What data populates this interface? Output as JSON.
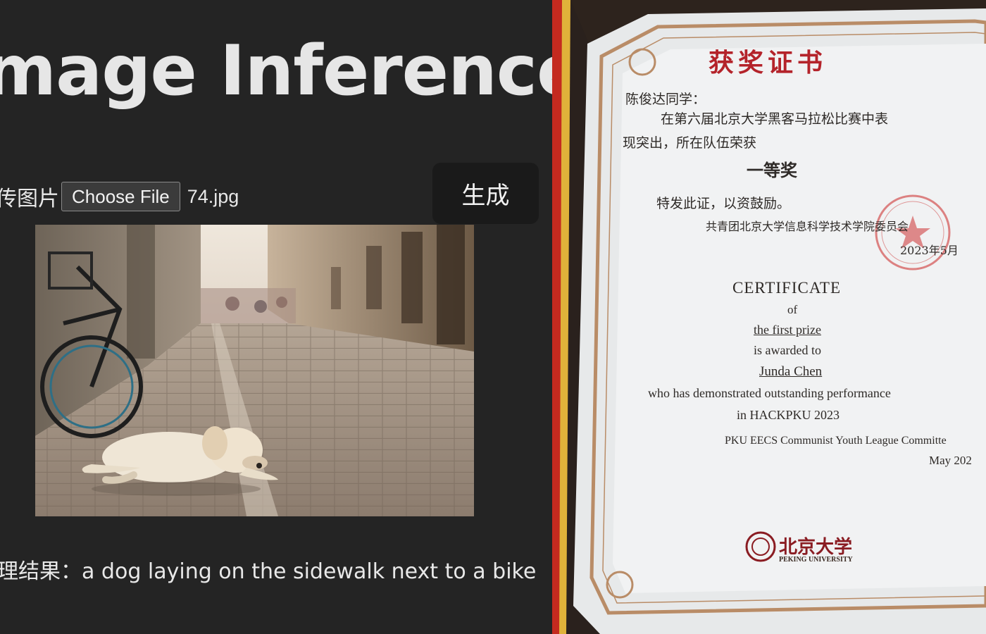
{
  "app": {
    "title": "mage Inference",
    "upload_label": "传图片",
    "choose_file": "Choose File",
    "file_name": "74.jpg",
    "generate": "生成",
    "result_label": "理结果：",
    "result_text": "a dog laying on the sidewalk next to a bike"
  },
  "certificate": {
    "zh_title": "获奖证书",
    "zh_salutation": "陈俊达同学：",
    "zh_body_1": "在第六届北京大学黑客马拉松比赛中表",
    "zh_body_2": "现突出，所在队伍荣获",
    "zh_prize": "一等奖",
    "zh_closing": "特发此证，以资鼓励。",
    "zh_issuer": "共青团北京大学信息科学技术学院委员会",
    "zh_date": "2023年5月",
    "en_title": "CERTIFICATE",
    "en_of": "of",
    "en_prize": "the first prize",
    "en_awarded": "is awarded to",
    "en_name": "Junda Chen",
    "en_reason": "who has demonstrated outstanding performance",
    "en_event": "in HACKPKU 2023",
    "en_issuer": "PKU EECS Communist Youth League Committe",
    "en_date": "May 202",
    "logo_text": "北京大学",
    "logo_subtext": "PEKING UNIVERSITY"
  },
  "colors": {
    "app_bg": "#242424",
    "button_bg": "#1a1a1a",
    "cert_red": "#b4232a",
    "cert_border": "#b98c67"
  }
}
